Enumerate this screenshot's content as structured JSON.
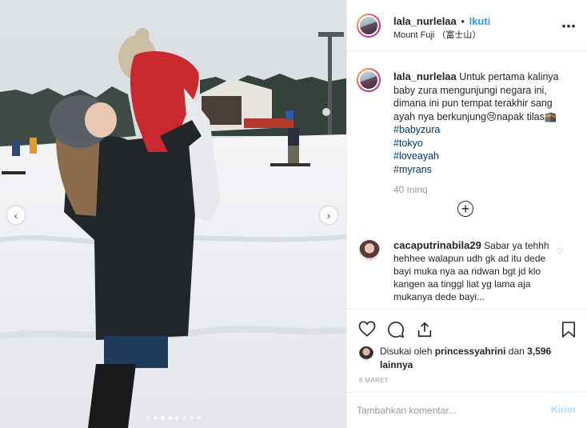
{
  "post": {
    "username": "lala_nurlelaa",
    "follow_label": "Ikuti",
    "location": "Mount Fuji （富士山）",
    "more_icon": "more-horizontal-icon",
    "photo": {
      "carousel_total": 8,
      "carousel_active_index": 2,
      "prev_icon": "chevron-left-icon",
      "next_icon": "chevron-right-icon"
    },
    "caption": {
      "username": "lala_nurlelaa",
      "text": "Untuk pertama kalinya baby zura mengunjungi negara ini, dimana ini pun tempat terakhir sang ayah nya berkunjung😢napak tilas🕋",
      "hashtags": [
        "#babyzura",
        "#tokyo",
        "#loveayah",
        "#myrans"
      ],
      "time": "40 minq"
    },
    "load_more_icon": "plus-circle-icon",
    "comments": [
      {
        "username": "cacaputrinabila29",
        "text": "Sabar ya tehhh hehhee walapun udh gk ad itu dede bayi muka nya aa ridwan bgt jd klo kangen aa tinggl liat yg lama aja mukanya dede bayi..."
      }
    ],
    "actions": {
      "like_icon": "heart-icon",
      "comment_icon": "comment-icon",
      "share_icon": "share-icon",
      "save_icon": "bookmark-icon"
    },
    "likes": {
      "prefix": "Disukai oleh",
      "user": "princessyahrini",
      "middle": "dan",
      "count": "3,596 lainnya"
    },
    "date": "6 MARET",
    "add_comment": {
      "placeholder": "Tambahkan komentar...",
      "post_label": "Kirim"
    }
  },
  "colors": {
    "accent": "#3897f0",
    "post_button_disabled": "#b2dffc",
    "hashtag": "#003569",
    "muted": "#999999",
    "border": "#efefef"
  }
}
